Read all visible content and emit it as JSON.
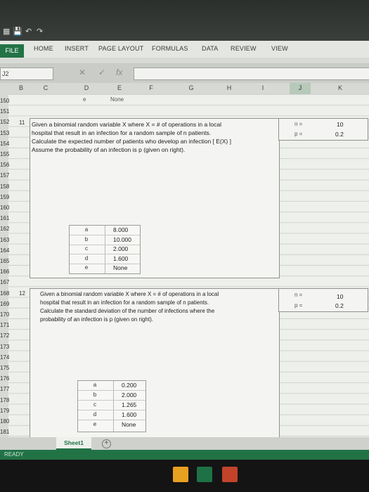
{
  "ribbon": {
    "file": "FILE",
    "tabs": [
      "HOME",
      "INSERT",
      "PAGE LAYOUT",
      "FORMULAS",
      "DATA",
      "REVIEW",
      "VIEW"
    ]
  },
  "namebox": "J2",
  "formula_bar": {
    "fx": "fx"
  },
  "columns": [
    "B",
    "C",
    "D",
    "E",
    "F",
    "G",
    "H",
    "I",
    "J",
    "K"
  ],
  "top_row_partial": {
    "d": "e",
    "e": "None"
  },
  "row_numbers": [
    "150",
    "151",
    "152",
    "153",
    "154",
    "155",
    "156",
    "157",
    "158",
    "159",
    "160",
    "161",
    "162",
    "163",
    "164",
    "165",
    "166",
    "167",
    "168",
    "169",
    "170",
    "171",
    "172",
    "173",
    "174",
    "175",
    "176",
    "177",
    "178",
    "179",
    "180",
    "181"
  ],
  "question1": {
    "number": "11",
    "lines": [
      "Given a binomial random variable X where X = # of operations in a local",
      "hospital that result in an infection for a random sample of n patients.",
      "Calculate the expected number of patients who develop an infection [ E(X) ]",
      "Assume the probability of an infection is p (given on right)."
    ],
    "n_label": "n =",
    "n_value": "10",
    "p_label": "p =",
    "p_value": "0.2",
    "options": [
      {
        "letter": "a",
        "value": "8.000"
      },
      {
        "letter": "b",
        "value": "10.000"
      },
      {
        "letter": "c",
        "value": "2.000"
      },
      {
        "letter": "d",
        "value": "1.600"
      },
      {
        "letter": "e",
        "value": "None"
      }
    ]
  },
  "question2": {
    "number": "12",
    "lines": [
      "Given a binomial random variable X where X = # of operations in a local",
      "hospital that result in an infection for a random sample of n patients.",
      "Calculate the standard deviation of the number of infections where the",
      "probability of an infection is p (given on right)."
    ],
    "n_label": "n =",
    "n_value": "10",
    "p_label": "p =",
    "p_value": "0.2",
    "options": [
      {
        "letter": "a",
        "value": "0.200"
      },
      {
        "letter": "b",
        "value": "2.000"
      },
      {
        "letter": "c",
        "value": "1.265"
      },
      {
        "letter": "d",
        "value": "1.600"
      },
      {
        "letter": "e",
        "value": "None"
      }
    ]
  },
  "sheet_tab": "Sheet1",
  "add_sheet": "+",
  "status": "READY",
  "colors": {
    "excel_green": "#217346",
    "cell_bg": "#eef0ec"
  }
}
